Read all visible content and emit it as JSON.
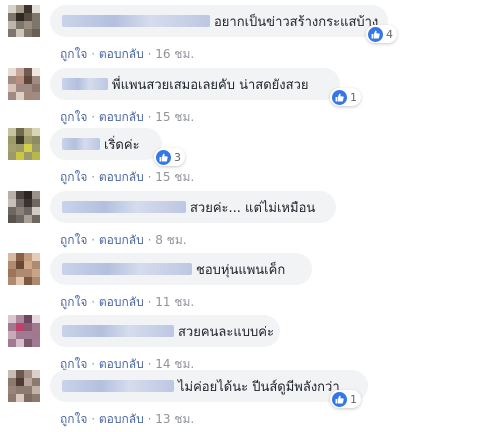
{
  "colors": {
    "bubble": "#f2f3f5",
    "like_blue": "#3578e5",
    "link": "#4b67a1",
    "meta": "#90949c"
  },
  "like_icon": "thumbs-up-icon",
  "comments": [
    {
      "text": "อยากเป็นข่าวสร้างกระแสบ้าง",
      "like_label": "ถูกใจ",
      "reply_label": "ตอบกลับ",
      "time": "16 ชม.",
      "reactions": "4"
    },
    {
      "text": "พี่แพนสวยเสมอเลยคับ น่าสดยังสวย",
      "like_label": "ถูกใจ",
      "reply_label": "ตอบกลับ",
      "time": "15 ชม.",
      "reactions": "1"
    },
    {
      "text": "เริ่ดค่ะ",
      "like_label": "ถูกใจ",
      "reply_label": "ตอบกลับ",
      "time": "15 ชม.",
      "reactions": "3"
    },
    {
      "text": "สวยค่ะ... แต่ไม่เหมือน",
      "like_label": "ถูกใจ",
      "reply_label": "ตอบกลับ",
      "time": "8 ชม.",
      "reactions": ""
    },
    {
      "text": "ชอบหุ่นแพนเค็ก",
      "like_label": "ถูกใจ",
      "reply_label": "ตอบกลับ",
      "time": "11 ชม.",
      "reactions": ""
    },
    {
      "text": "สวยคนละแบบค่ะ",
      "like_label": "ถูกใจ",
      "reply_label": "ตอบกลับ",
      "time": "14 ชม.",
      "reactions": ""
    },
    {
      "text": "ไม่ค่อยได้นะ ปีนส์ดูมีพลังกว่า",
      "like_label": "ถูกใจ",
      "reply_label": "ตอบกลับ",
      "time": "13 ชม.",
      "reactions": "1"
    }
  ]
}
